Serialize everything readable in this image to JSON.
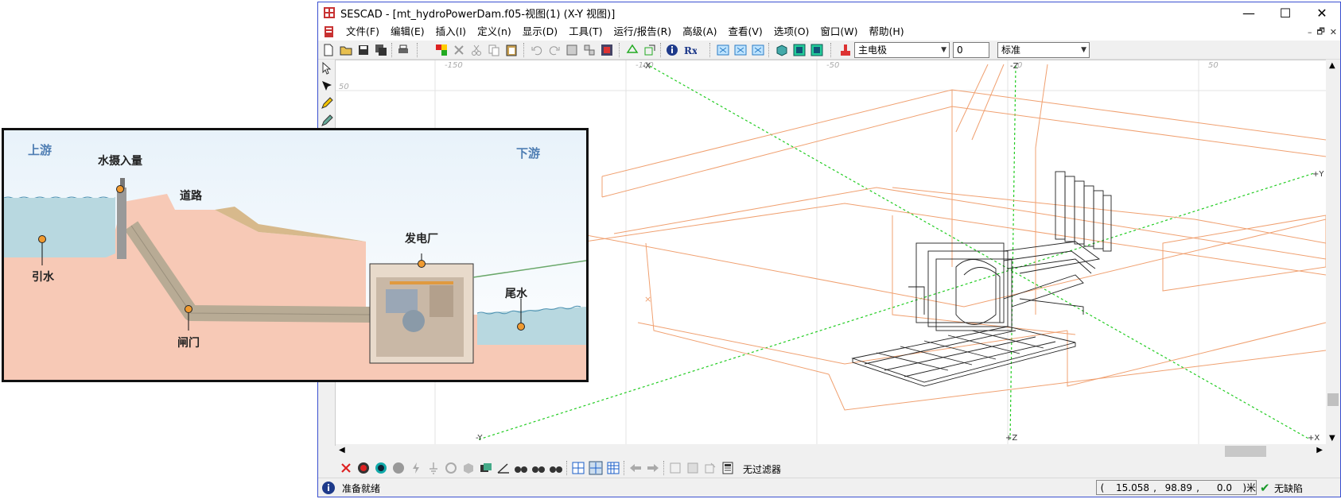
{
  "window": {
    "app_name": "SESCAD",
    "title": "SESCAD - [mt_hydroPowerDam.f05-视图(1) (X-Y 视图)]",
    "controls": {
      "minimize": "—",
      "maximize": "☐",
      "close": "✕"
    }
  },
  "menu": {
    "items": [
      "文件(F)",
      "编辑(E)",
      "插入(I)",
      "定义(n)",
      "显示(D)",
      "工具(T)",
      "运行/报告(R)",
      "高级(A)",
      "查看(V)",
      "选项(O)",
      "窗口(W)",
      "帮助(H)"
    ],
    "mdi_controls": {
      "minimize": "–",
      "restore": "🗗",
      "close": "✕"
    }
  },
  "toolbar": {
    "electrode_combo": "主电极",
    "number_field": "0",
    "style_combo": "标准"
  },
  "viewport": {
    "ruler_top": [
      "-150",
      "-100",
      "-50",
      "0",
      "50"
    ],
    "ruler_left": [
      "50"
    ],
    "axis_labels": {
      "top_x": "-X",
      "top_z": "-Z",
      "right_y": "+Y",
      "bottom_y": "-Y",
      "bottom_z": "+Z",
      "bottom_x": "+X"
    }
  },
  "bottom_toolbar": {
    "filter_label": "无过滤器"
  },
  "status": {
    "ready_text": "准备就绪",
    "coord_x": "15.058",
    "coord_y": "98.89",
    "coord_z": "0.0",
    "unit": ")米",
    "open_paren": "(",
    "comma": ",",
    "defect_text": "无缺陷"
  },
  "overlay": {
    "upstream": "上游",
    "downstream": "下游",
    "intake": "水摄入量",
    "road": "道路",
    "powerhouse": "发电厂",
    "headwater": "引水",
    "tailwater": "尾水",
    "gate": "闸门"
  },
  "colors": {
    "accent_border": "#3a4fd0",
    "orange_wire": "#f0a070",
    "green_axis": "#22cc22",
    "water": "#b8d8e0",
    "earth": "#f7c9b6"
  }
}
